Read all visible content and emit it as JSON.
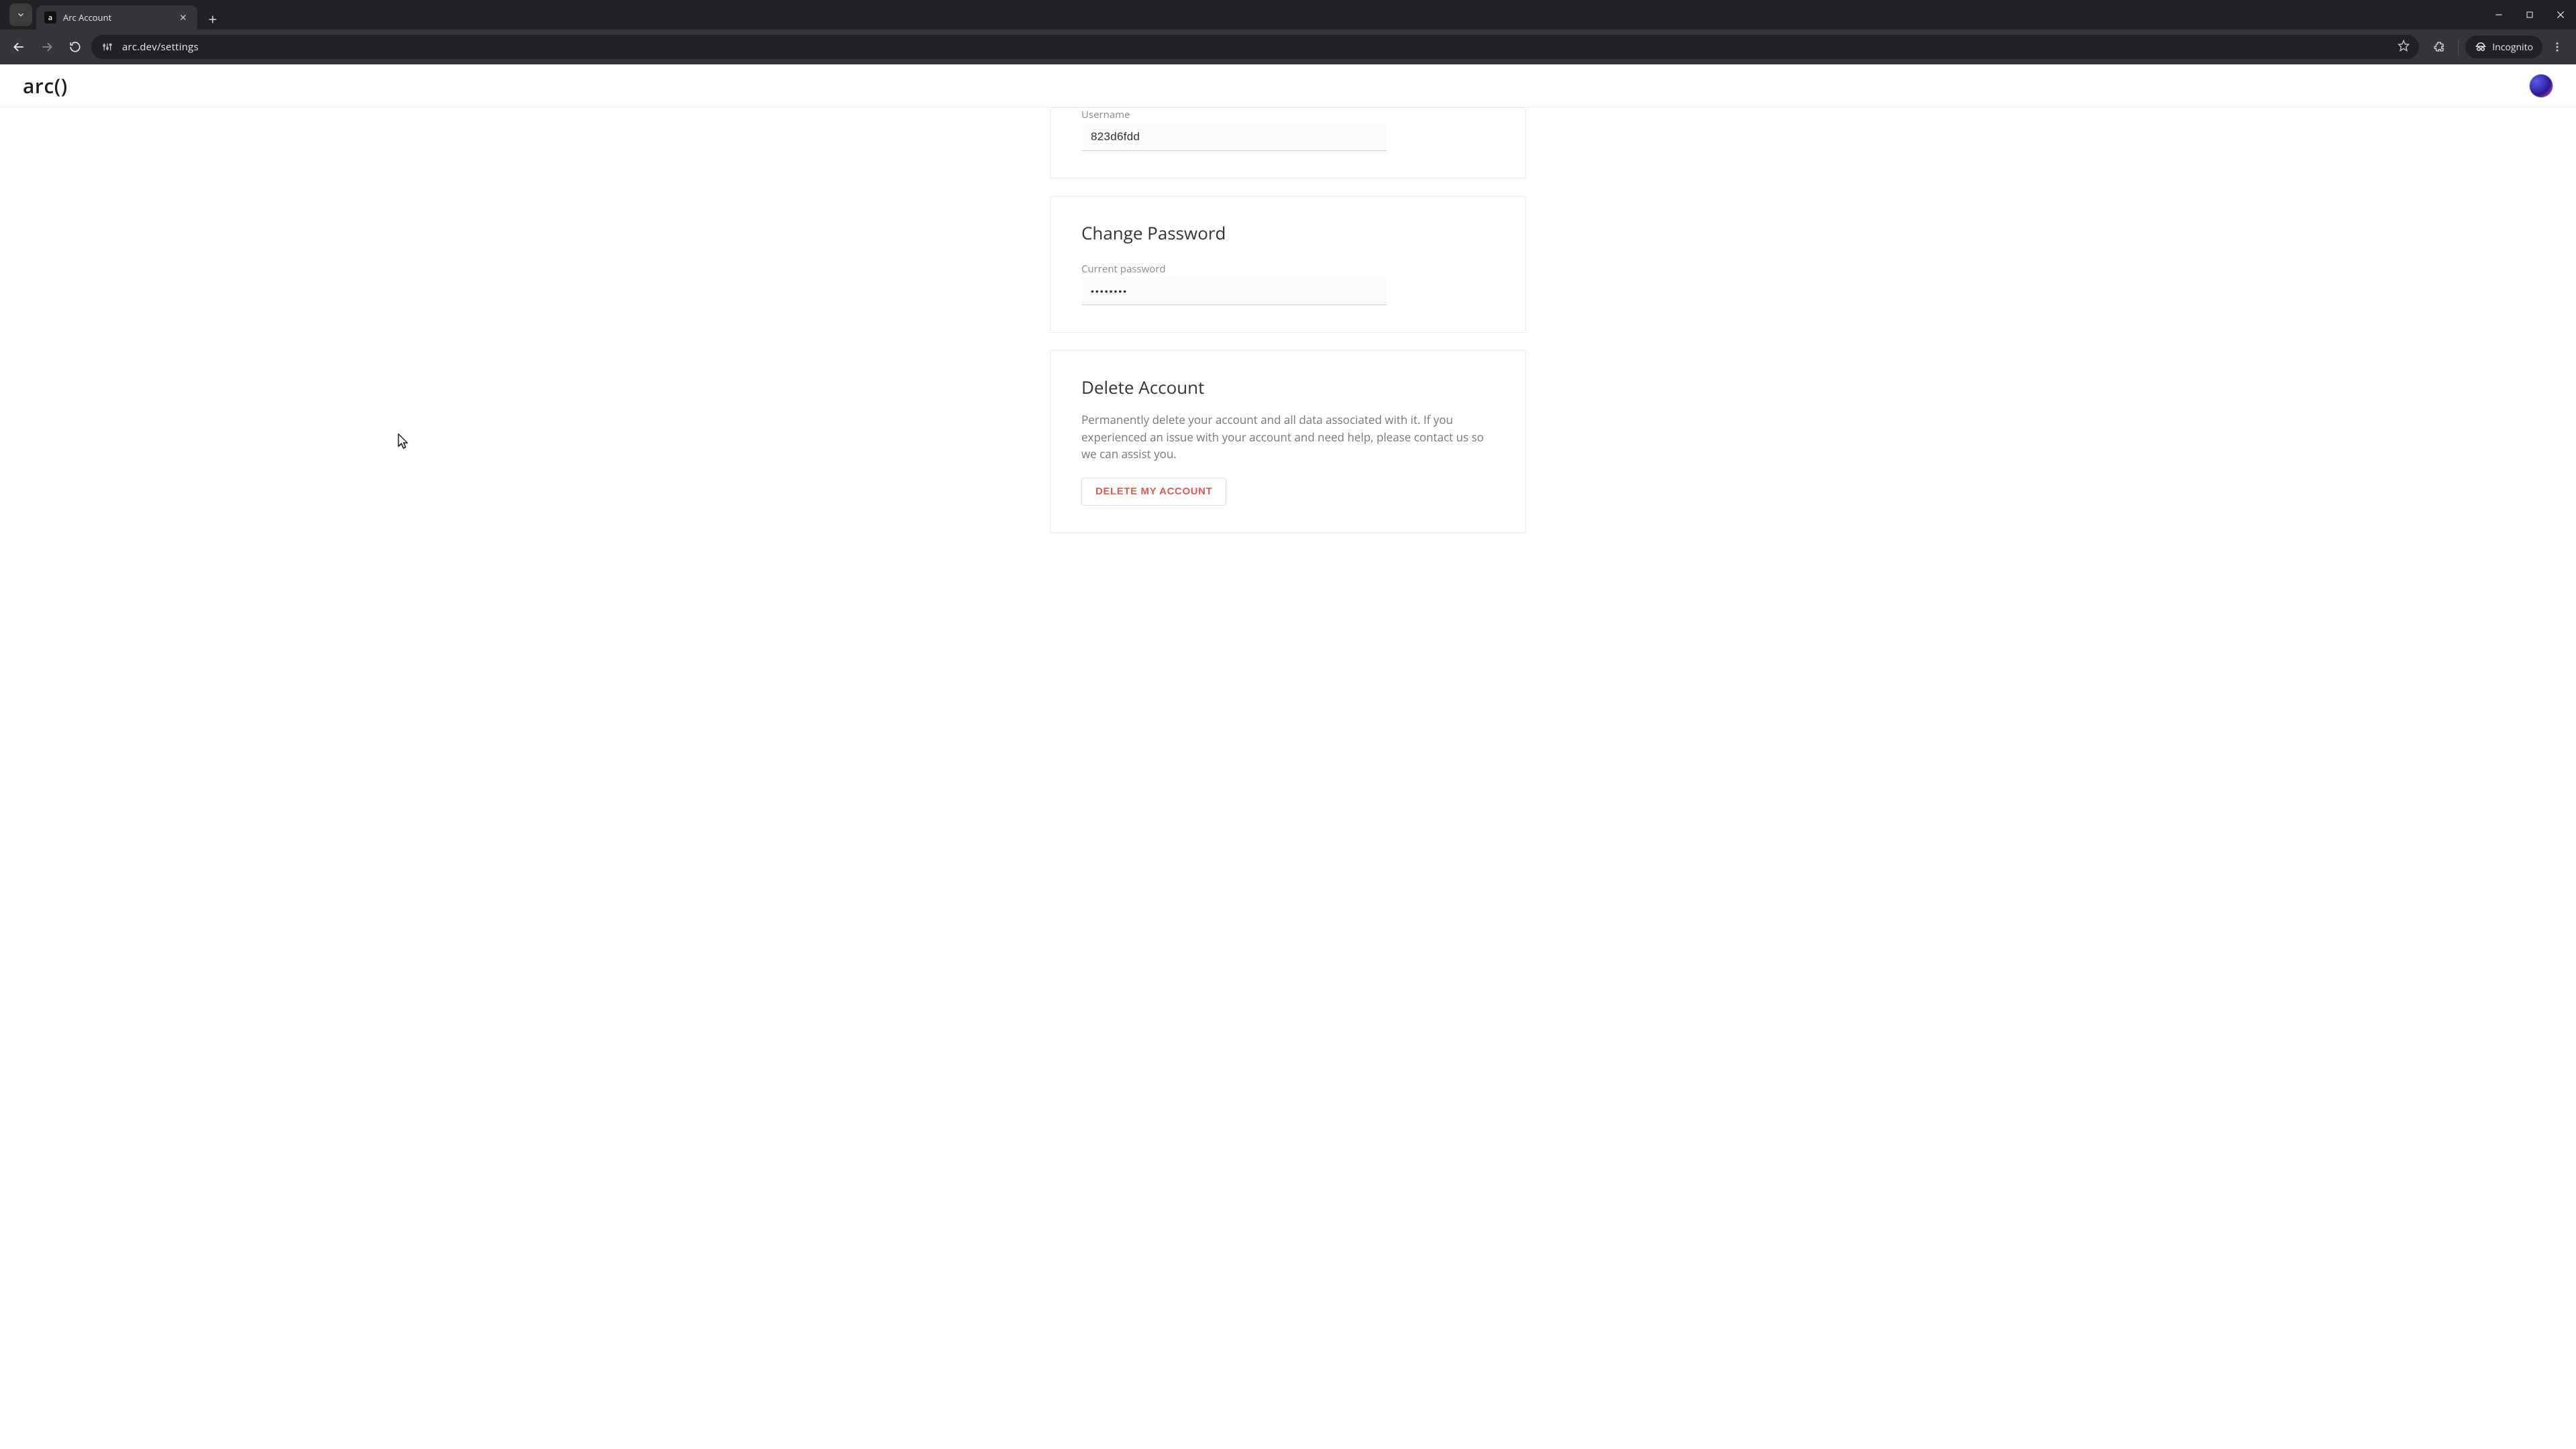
{
  "browser": {
    "tab_title": "Arc Account",
    "url": "arc.dev/settings",
    "incognito_label": "Incognito"
  },
  "header": {
    "logo_text": "arc()"
  },
  "username_section": {
    "label": "Username",
    "value": "823d6fdd"
  },
  "password_section": {
    "title": "Change Password",
    "current_label": "Current password",
    "current_value": "••••••••"
  },
  "delete_section": {
    "title": "Delete Account",
    "description": "Permanently delete your account and all data associated with it. If you experienced an issue with your account and need help, please contact us so we can assist you.",
    "button_label": "DELETE MY ACCOUNT"
  }
}
